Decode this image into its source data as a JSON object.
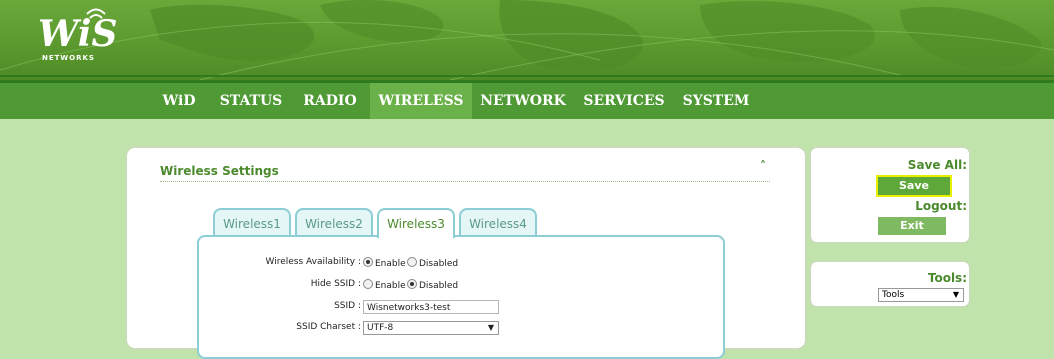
{
  "brand": {
    "logo_text": "WiS",
    "logo_subtext": "NETWORKS"
  },
  "nav": {
    "items": [
      {
        "label": "WiD",
        "active": false
      },
      {
        "label": "STATUS",
        "active": false
      },
      {
        "label": "RADIO",
        "active": false
      },
      {
        "label": "WIRELESS",
        "active": true
      },
      {
        "label": "NETWORK",
        "active": false
      },
      {
        "label": "SERVICES",
        "active": false
      },
      {
        "label": "SYSTEM",
        "active": false
      }
    ]
  },
  "panel": {
    "title": "Wireless Settings",
    "collapse_icon": "chevron-up-icon",
    "tabs": [
      {
        "label": "Wireless1",
        "active": false
      },
      {
        "label": "Wireless2",
        "active": false
      },
      {
        "label": "Wireless3",
        "active": true
      },
      {
        "label": "Wireless4",
        "active": false
      }
    ],
    "fields": {
      "availability": {
        "label": "Wireless Availability :",
        "enable": "Enable",
        "disable": "Disabled",
        "selected": "Enable"
      },
      "hide_ssid": {
        "label": "Hide SSID :",
        "enable": "Enable",
        "disable": "Disabled",
        "selected": "Disabled"
      },
      "ssid": {
        "label": "SSID :",
        "value": "Wisnetworks3-test"
      },
      "ssid_charset": {
        "label": "SSID Charset :",
        "value": "UTF-8"
      }
    }
  },
  "sidebar": {
    "save_all_label": "Save All:",
    "save_button": "Save",
    "logout_label": "Logout:",
    "exit_button": "Exit",
    "tools_label": "Tools:",
    "tools_select": "Tools"
  },
  "colors": {
    "nav_bg": "#4f9a35",
    "nav_active": "#6bb14a",
    "page_bg": "#bfe3ab",
    "save_highlight": "#e8f000",
    "exit_button": "#7fba63"
  }
}
